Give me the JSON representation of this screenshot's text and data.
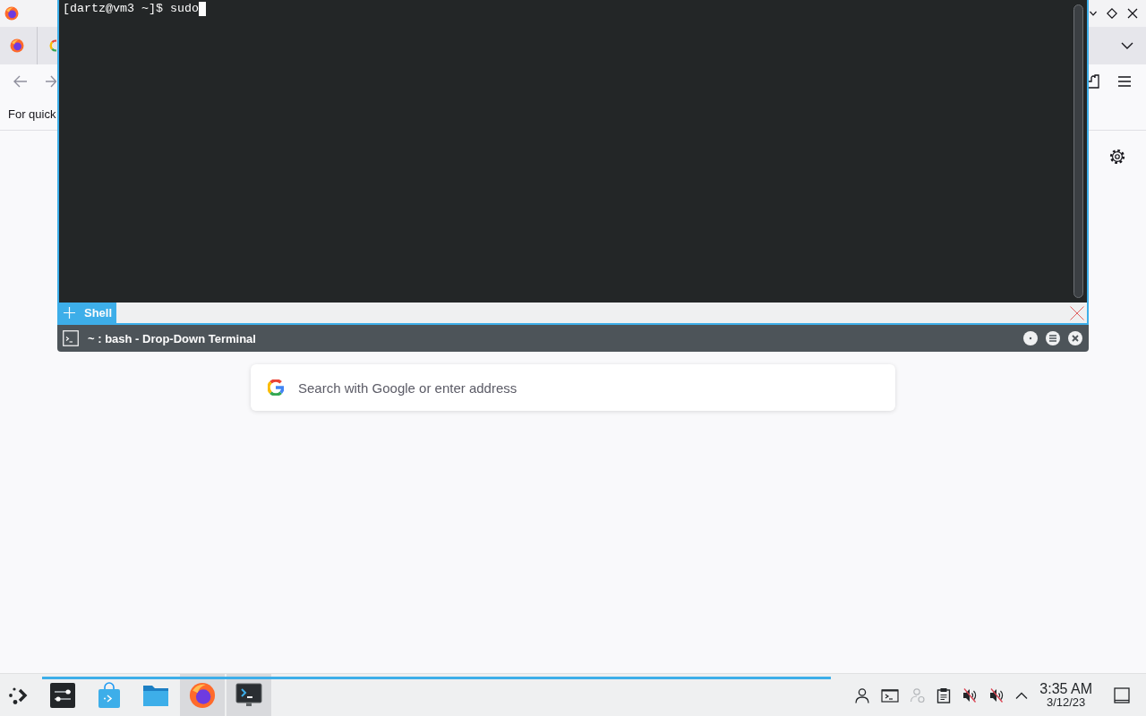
{
  "browser": {
    "bookmarks_toolbar": {
      "text": "For quick"
    },
    "new_tab_page": {
      "search": {
        "placeholder": "Search with Google or enter address"
      }
    }
  },
  "terminal": {
    "lines": [
      "[dartz@vm3 ~]$ sudo"
    ],
    "tabs": [
      {
        "label": "Shell",
        "selected": true
      }
    ],
    "title": "~ : bash - Drop-Down Terminal"
  },
  "taskbar": {
    "tasks": [
      {
        "kind": "settings",
        "open": false
      },
      {
        "kind": "store",
        "open": false
      },
      {
        "kind": "files",
        "open": false
      },
      {
        "kind": "browser",
        "open": true
      },
      {
        "kind": "terminal",
        "open": true
      }
    ],
    "tray": {
      "audio": [
        {
          "muted": true
        },
        {
          "muted": true
        }
      ]
    },
    "clock": {
      "time": "3:35 AM",
      "date": "3/12/23"
    }
  }
}
